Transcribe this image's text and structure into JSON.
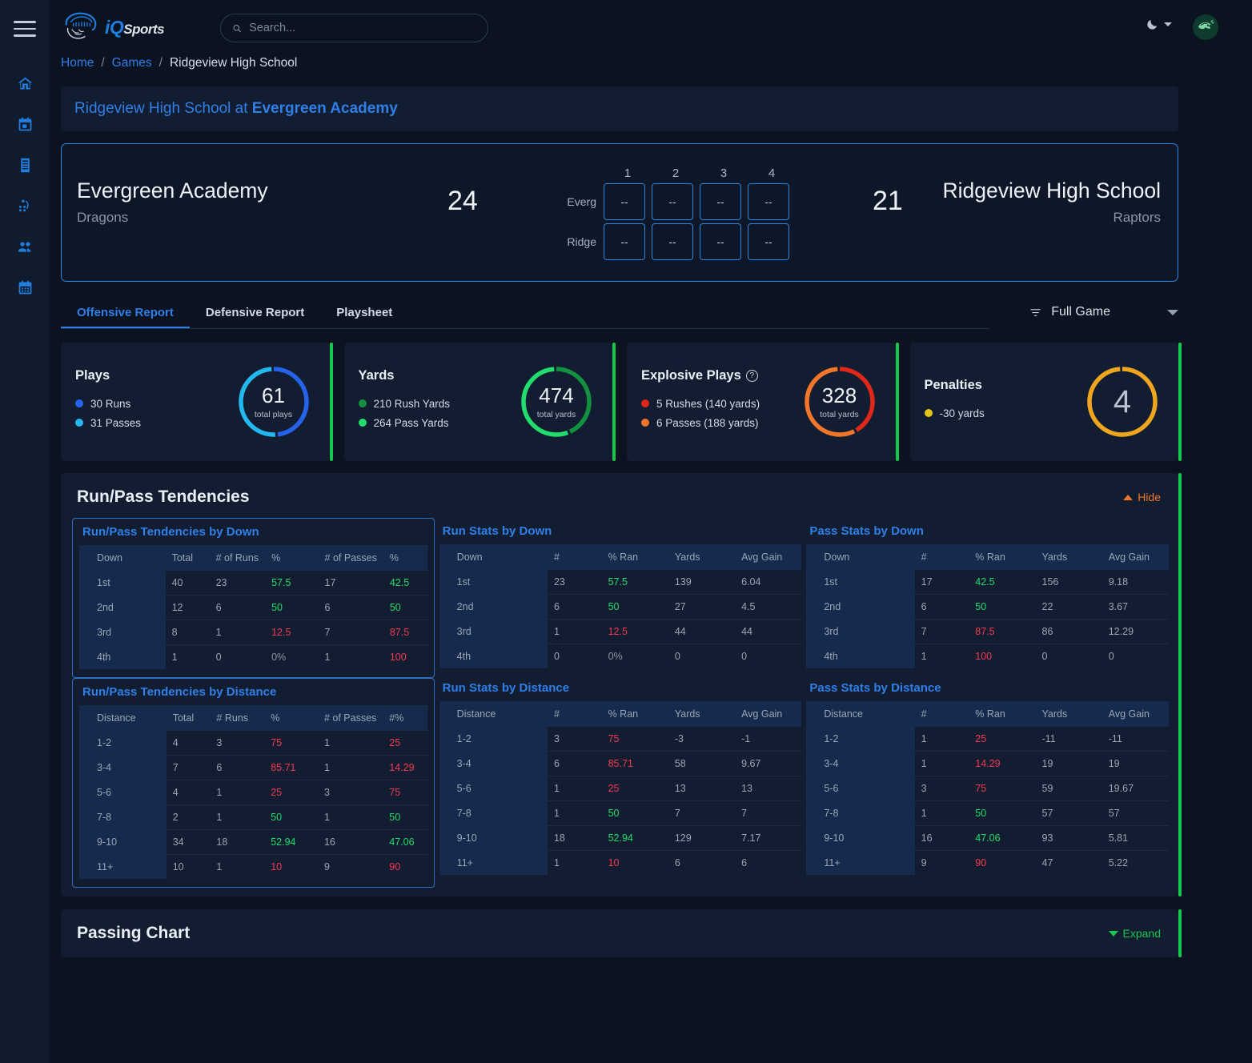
{
  "brand": {
    "name": "iQ",
    "suffix": "Sports"
  },
  "search": {
    "placeholder": "Search..."
  },
  "sidebar": {
    "items": [
      {
        "name": "home",
        "label": "Home"
      },
      {
        "name": "calendar",
        "label": "Calendar"
      },
      {
        "name": "reports",
        "label": "Reports"
      },
      {
        "name": "formations",
        "label": "Formations"
      },
      {
        "name": "roster",
        "label": "Roster"
      },
      {
        "name": "schedule",
        "label": "Schedule"
      }
    ]
  },
  "breadcrumb": {
    "home": "Home",
    "games": "Games",
    "current": "Ridgeview High School",
    "sep": "/"
  },
  "matchup": {
    "away": "Ridgeview High School",
    "at": " at ",
    "home": "Evergreen Academy"
  },
  "scoreboard": {
    "home_team": "Evergreen Academy",
    "home_mascot": "Dragons",
    "home_score": "24",
    "away_team": "Ridgeview High School",
    "away_mascot": "Raptors",
    "away_score": "21",
    "quarters": [
      "1",
      "2",
      "3",
      "4"
    ],
    "rows": [
      {
        "label": "Everg",
        "values": [
          "--",
          "--",
          "--",
          "--"
        ]
      },
      {
        "label": "Ridge",
        "values": [
          "--",
          "--",
          "--",
          "--"
        ]
      }
    ]
  },
  "tabs": [
    {
      "label": "Offensive Report",
      "active": true
    },
    {
      "label": "Defensive Report",
      "active": false
    },
    {
      "label": "Playsheet",
      "active": false
    }
  ],
  "filter": {
    "label": "Full Game"
  },
  "cards": [
    {
      "title": "Plays",
      "legend": [
        {
          "label": "30 Runs",
          "color": "#2563eb"
        },
        {
          "label": "31 Passes",
          "color": "#22b8f0"
        }
      ],
      "center_value": "61",
      "center_label": "total plays",
      "segments": [
        {
          "value": 30,
          "color": "#2563eb"
        },
        {
          "value": 31,
          "color": "#22b8f0"
        }
      ]
    },
    {
      "title": "Yards",
      "legend": [
        {
          "label": "210 Rush Yards",
          "color": "#13913f"
        },
        {
          "label": "264 Pass Yards",
          "color": "#21dd6d"
        }
      ],
      "center_value": "474",
      "center_label": "total yards",
      "segments": [
        {
          "value": 210,
          "color": "#13913f"
        },
        {
          "value": 264,
          "color": "#21dd6d"
        }
      ]
    },
    {
      "title": "Explosive Plays",
      "help": "?",
      "legend": [
        {
          "label": "5 Rushes (140 yards)",
          "color": "#e02718"
        },
        {
          "label": "6 Passes (188 yards)",
          "color": "#f2762a"
        }
      ],
      "center_value": "328",
      "center_label": "total yards",
      "segments": [
        {
          "value": 140,
          "color": "#e02718"
        },
        {
          "value": 188,
          "color": "#f2762a"
        }
      ]
    },
    {
      "title": "Penalties",
      "legend": [
        {
          "label": "-30 yards",
          "color": "#e8c51c"
        }
      ],
      "center_value": "4",
      "center_label": "",
      "segments": [
        {
          "value": 1,
          "color": "#f0a51e"
        }
      ]
    }
  ],
  "tendencies": {
    "title": "Run/Pass Tendencies",
    "toggle": "Hide",
    "tables": [
      {
        "title": "Run/Pass Tendencies by Down",
        "framed": true,
        "headers": [
          "Down",
          "Total",
          "# of Runs",
          "%",
          "# of Passes",
          "%"
        ],
        "rows": [
          [
            "1st",
            "40",
            "23",
            "57.5",
            "17",
            "42.5"
          ],
          [
            "2nd",
            "12",
            "6",
            "50",
            "6",
            "50"
          ],
          [
            "3rd",
            "8",
            "1",
            "12.5",
            "7",
            "87.5"
          ],
          [
            "4th",
            "1",
            "0",
            "0%",
            "1",
            "100"
          ]
        ],
        "styles": [
          [
            "",
            "",
            "",
            "pos",
            "",
            "pos"
          ],
          [
            "",
            "",
            "",
            "pos",
            "",
            "pos"
          ],
          [
            "",
            "",
            "",
            "neg",
            "",
            "neg"
          ],
          [
            "",
            "",
            "",
            "mut",
            "",
            "neg"
          ]
        ]
      },
      {
        "title": "Run Stats by Down",
        "framed": false,
        "headers": [
          "Down",
          "#",
          "% Ran",
          "Yards",
          "Avg Gain"
        ],
        "rows": [
          [
            "1st",
            "23",
            "57.5",
            "139",
            "6.04"
          ],
          [
            "2nd",
            "6",
            "50",
            "27",
            "4.5"
          ],
          [
            "3rd",
            "1",
            "12.5",
            "44",
            "44"
          ],
          [
            "4th",
            "0",
            "0%",
            "0",
            "0"
          ]
        ],
        "styles": [
          [
            "",
            "",
            "pos",
            "",
            ""
          ],
          [
            "",
            "",
            "pos",
            "",
            ""
          ],
          [
            "",
            "",
            "neg",
            "",
            ""
          ],
          [
            "",
            "",
            "mut",
            "",
            ""
          ]
        ]
      },
      {
        "title": "Pass Stats by Down",
        "framed": false,
        "headers": [
          "Down",
          "#",
          "% Ran",
          "Yards",
          "Avg Gain"
        ],
        "rows": [
          [
            "1st",
            "17",
            "42.5",
            "156",
            "9.18"
          ],
          [
            "2nd",
            "6",
            "50",
            "22",
            "3.67"
          ],
          [
            "3rd",
            "7",
            "87.5",
            "86",
            "12.29"
          ],
          [
            "4th",
            "1",
            "100",
            "0",
            "0"
          ]
        ],
        "styles": [
          [
            "",
            "",
            "pos",
            "",
            ""
          ],
          [
            "",
            "",
            "pos",
            "",
            ""
          ],
          [
            "",
            "",
            "neg",
            "",
            ""
          ],
          [
            "",
            "",
            "neg",
            "",
            ""
          ]
        ]
      },
      {
        "title": "Run/Pass Tendencies by Distance",
        "framed": true,
        "headers": [
          "Distance",
          "Total",
          "# Runs",
          "%",
          "# of Passes",
          "#%"
        ],
        "rows": [
          [
            "1-2",
            "4",
            "3",
            "75",
            "1",
            "25"
          ],
          [
            "3-4",
            "7",
            "6",
            "85.71",
            "1",
            "14.29"
          ],
          [
            "5-6",
            "4",
            "1",
            "25",
            "3",
            "75"
          ],
          [
            "7-8",
            "2",
            "1",
            "50",
            "1",
            "50"
          ],
          [
            "9-10",
            "34",
            "18",
            "52.94",
            "16",
            "47.06"
          ],
          [
            "11+",
            "10",
            "1",
            "10",
            "9",
            "90"
          ]
        ],
        "styles": [
          [
            "",
            "",
            "",
            "neg",
            "",
            "neg"
          ],
          [
            "",
            "",
            "",
            "neg",
            "",
            "neg"
          ],
          [
            "",
            "",
            "",
            "neg",
            "",
            "neg"
          ],
          [
            "",
            "",
            "",
            "pos",
            "",
            "pos"
          ],
          [
            "",
            "",
            "",
            "pos",
            "",
            "pos"
          ],
          [
            "",
            "",
            "",
            "neg",
            "",
            "neg"
          ]
        ]
      },
      {
        "title": "Run Stats by Distance",
        "framed": false,
        "headers": [
          "Distance",
          "#",
          "% Ran",
          "Yards",
          "Avg Gain"
        ],
        "rows": [
          [
            "1-2",
            "3",
            "75",
            "-3",
            "-1"
          ],
          [
            "3-4",
            "6",
            "85.71",
            "58",
            "9.67"
          ],
          [
            "5-6",
            "1",
            "25",
            "13",
            "13"
          ],
          [
            "7-8",
            "1",
            "50",
            "7",
            "7"
          ],
          [
            "9-10",
            "18",
            "52.94",
            "129",
            "7.17"
          ],
          [
            "11+",
            "1",
            "10",
            "6",
            "6"
          ]
        ],
        "styles": [
          [
            "",
            "",
            "neg",
            "",
            ""
          ],
          [
            "",
            "",
            "neg",
            "",
            ""
          ],
          [
            "",
            "",
            "neg",
            "",
            ""
          ],
          [
            "",
            "",
            "pos",
            "",
            ""
          ],
          [
            "",
            "",
            "pos",
            "",
            ""
          ],
          [
            "",
            "",
            "neg",
            "",
            ""
          ]
        ]
      },
      {
        "title": "Pass Stats by Distance",
        "framed": false,
        "headers": [
          "Distance",
          "#",
          "% Ran",
          "Yards",
          "Avg Gain"
        ],
        "rows": [
          [
            "1-2",
            "1",
            "25",
            "-11",
            "-11"
          ],
          [
            "3-4",
            "1",
            "14.29",
            "19",
            "19"
          ],
          [
            "5-6",
            "3",
            "75",
            "59",
            "19.67"
          ],
          [
            "7-8",
            "1",
            "50",
            "57",
            "57"
          ],
          [
            "9-10",
            "16",
            "47.06",
            "93",
            "5.81"
          ],
          [
            "11+",
            "9",
            "90",
            "47",
            "5.22"
          ]
        ],
        "styles": [
          [
            "",
            "",
            "neg",
            "",
            ""
          ],
          [
            "",
            "",
            "neg",
            "",
            ""
          ],
          [
            "",
            "",
            "neg",
            "",
            ""
          ],
          [
            "",
            "",
            "pos",
            "",
            ""
          ],
          [
            "",
            "",
            "pos",
            "",
            ""
          ],
          [
            "",
            "",
            "neg",
            "",
            ""
          ]
        ]
      }
    ]
  },
  "passing_chart": {
    "title": "Passing Chart",
    "toggle": "Expand"
  }
}
